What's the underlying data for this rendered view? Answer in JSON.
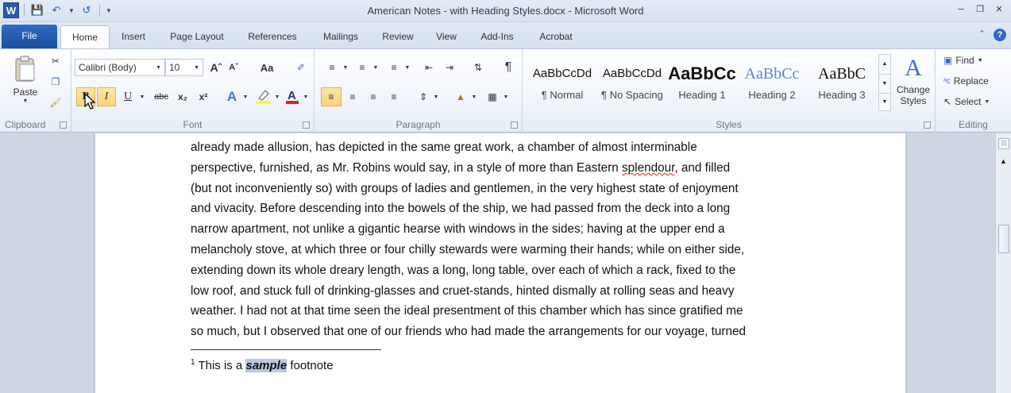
{
  "window": {
    "title": "American Notes - with Heading Styles.docx  -  Microsoft Word",
    "app_icon": "W"
  },
  "tabs": {
    "file": "File",
    "items": [
      "Home",
      "Insert",
      "Page Layout",
      "References",
      "Mailings",
      "Review",
      "View",
      "Add-Ins",
      "Acrobat"
    ],
    "active": "Home"
  },
  "clipboard": {
    "paste_label": "Paste",
    "group_label": "Clipboard"
  },
  "font": {
    "font_name": "Calibri (Body)",
    "font_size": "10",
    "group_label": "Font",
    "bold_label": "B",
    "italic_label": "I",
    "underline_label": "U",
    "strike_label": "abc",
    "subscript_label": "x₂",
    "superscript_label": "x²",
    "grow_label": "Aˆ",
    "shrink_label": "Aˇ",
    "case_label": "Aa",
    "highlight_color": "#ffff00",
    "font_color": "#e0201b"
  },
  "paragraph": {
    "group_label": "Paragraph"
  },
  "styles": {
    "group_label": "Styles",
    "items": [
      {
        "preview": "AaBbCcDd",
        "label": "¶ Normal"
      },
      {
        "preview": "AaBbCcDd",
        "label": "¶ No Spacing"
      },
      {
        "preview": "AaBbCс",
        "label": "Heading 1"
      },
      {
        "preview": "AaBbCc",
        "label": "Heading 2"
      },
      {
        "preview": "AaBbC",
        "label": "Heading 3"
      }
    ],
    "change_styles_line1": "Change",
    "change_styles_line2": "Styles"
  },
  "editing": {
    "group_label": "Editing",
    "find_label": "Find",
    "replace_label": "Replace",
    "select_label": "Select"
  },
  "document": {
    "lines": [
      "already made allusion, has depicted in the same great work, a chamber of almost interminable",
      "perspective, furnished, as Mr. Robins would say, in a style of more than Eastern ",
      "(but not inconveniently so) with groups of ladies and gentlemen, in the very highest state of enjoyment",
      "and vivacity. Before descending into the bowels of the ship, we had passed from the deck into a long",
      "narrow apartment, not unlike a gigantic hearse with windows in the sides; having at the upper end a",
      "melancholy stove, at which three or four chilly stewards were warming their hands; while on either side,",
      "extending down its whole dreary length, was a long, long table, over each of which a rack, fixed to the",
      "low roof, and stuck full of drinking-glasses and cruet-stands, hinted dismally at rolling seas and heavy",
      "weather. I had not at that time seen the ideal presentment of this chamber which has since gratified me",
      "so much, but I observed that one of our friends who had made the arrangements for our voyage, turned"
    ],
    "misspelled_word": "splendour",
    "line2_tail": ", and filled",
    "footnote_number": "1",
    "footnote_before": " This is a ",
    "footnote_selected": "sample",
    "footnote_after": " footnote"
  }
}
